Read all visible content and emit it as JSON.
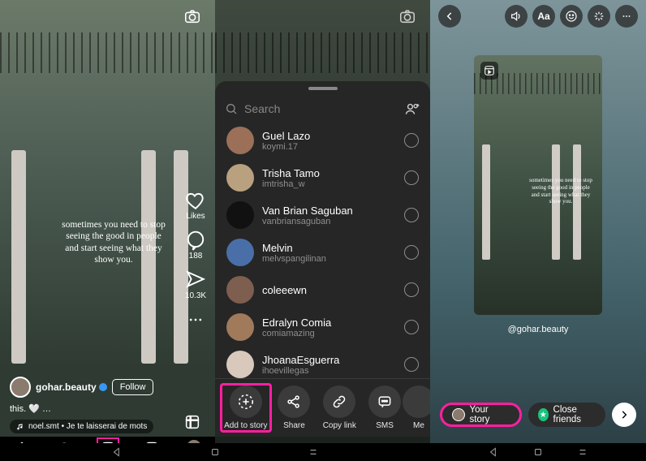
{
  "img": {
    "quote": "sometimes you need to stop seeing the good in people and start seeing what they show you.",
    "author": "gohar.beauty",
    "follow": "Follow",
    "caption_line": "this. 🤍 …",
    "music": "noel.smt • Je te laisserai de mots",
    "reel_attrib": "@gohar.beauty"
  },
  "reels": {
    "likes": "Likes",
    "comments": "188",
    "shares": "10.3K"
  },
  "sheet": {
    "search_placeholder": "Search",
    "contacts": [
      {
        "name": "Guel Lazo",
        "user": "koymi.17",
        "av": "#9b6f58"
      },
      {
        "name": "Trisha Tamo",
        "user": "imtrisha_w",
        "av": "#b9a07f"
      },
      {
        "name": "Van Brian Saguban",
        "user": "vanbriansaguban",
        "av": "#111"
      },
      {
        "name": "Melvin",
        "user": "melvspangilinan",
        "av": "#4a6fa8"
      },
      {
        "name": "coleeewn",
        "user": "",
        "av": "#7e5e4f"
      },
      {
        "name": "Edralyn Comia",
        "user": "comiamazing",
        "av": "#a07a5b"
      },
      {
        "name": "JhoanaEsguerra",
        "user": "ihoevillegas",
        "av": "#d8c9bc"
      }
    ],
    "actions": {
      "add_to_story": "Add to story",
      "share": "Share",
      "copy_link": "Copy link",
      "sms": "SMS",
      "messenger": "Me"
    }
  },
  "story": {
    "your_story": "Your story",
    "close_friends": "Close friends"
  }
}
